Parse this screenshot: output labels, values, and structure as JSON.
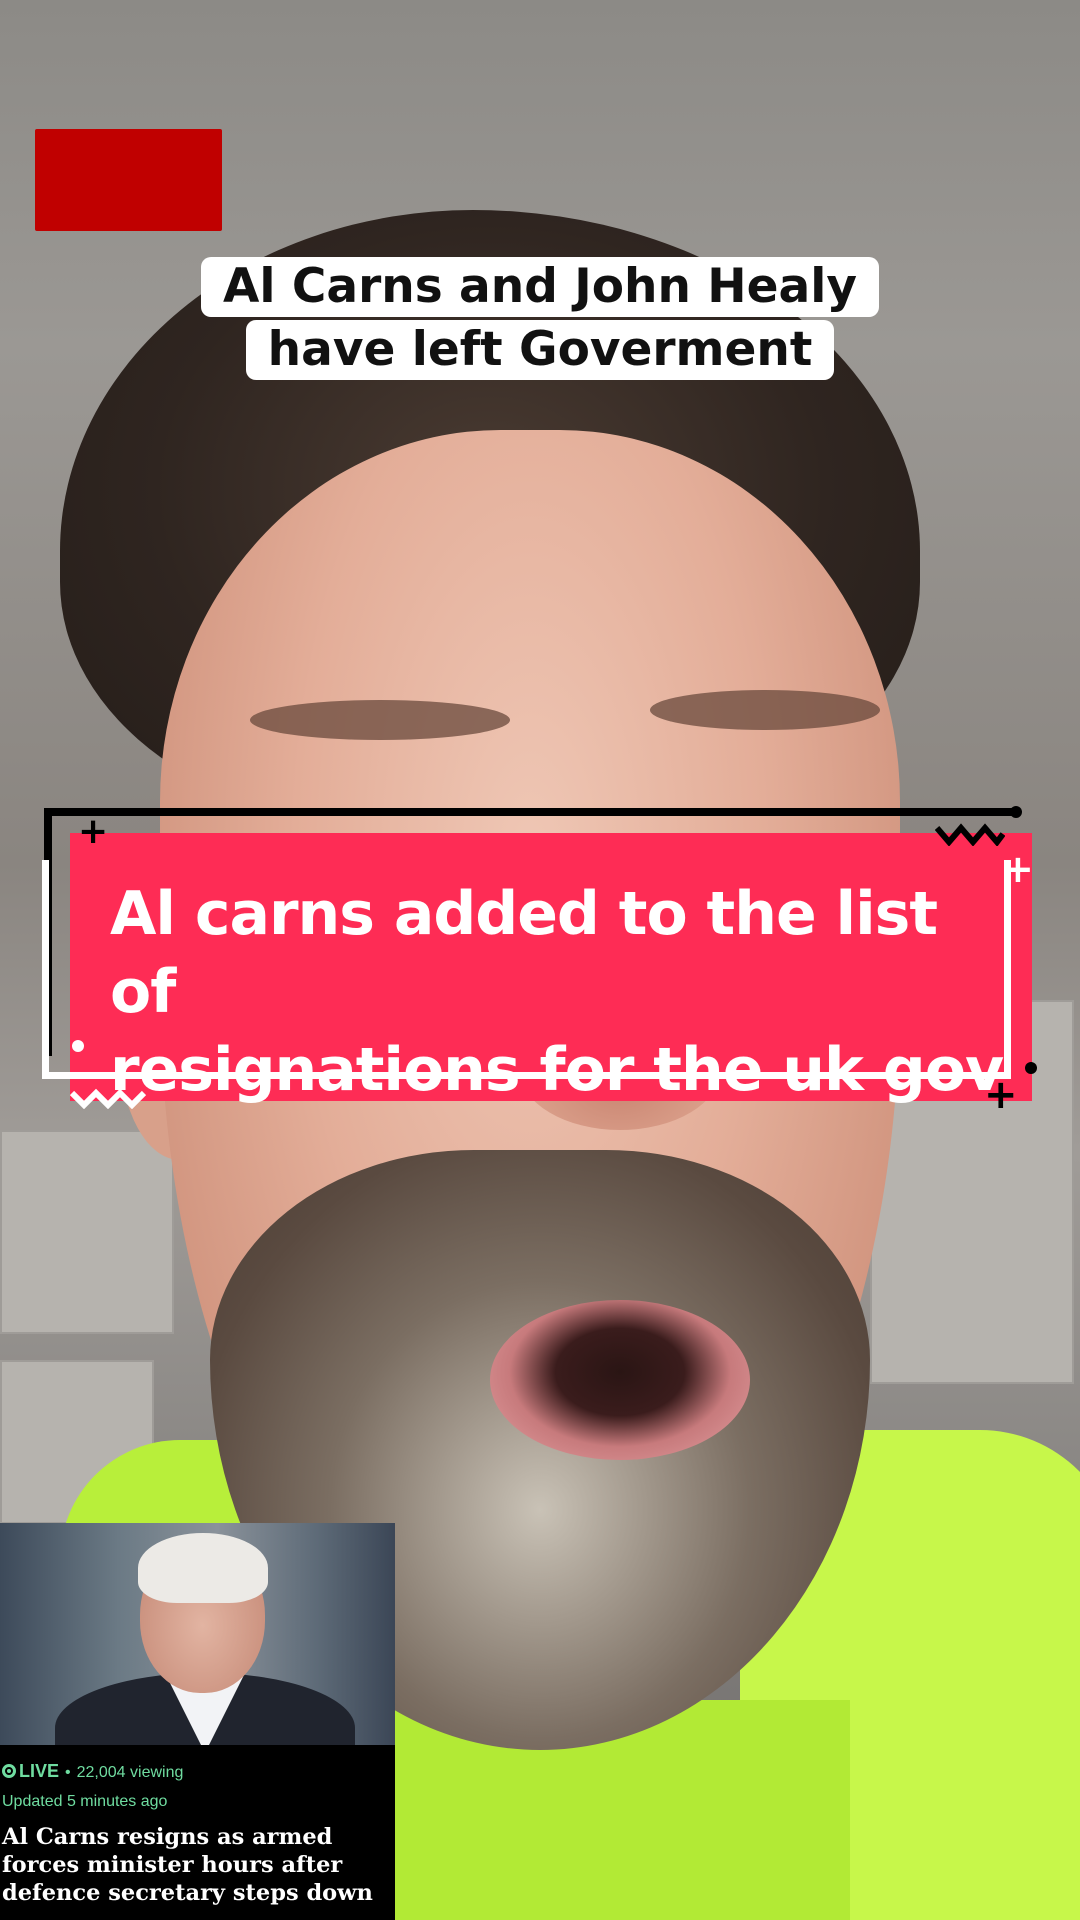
{
  "captions": {
    "line1": "Al Carns and John Healy",
    "line2": "have left Goverment"
  },
  "banner": {
    "line1": "Al carns added to the list of",
    "line2": "resignations for the uk gov"
  },
  "news_card": {
    "live_label": "LIVE",
    "separator": "•",
    "viewers": "22,004 viewing",
    "updated": "Updated 5 minutes ago",
    "headline_line1": "Al Carns resigns as armed",
    "headline_line2": "forces minister hours after",
    "headline_line3": "defence secretary steps down"
  },
  "colors": {
    "banner_red": "#fe2c55",
    "logo_red": "#c00000",
    "live_green": "#6fdca0"
  }
}
